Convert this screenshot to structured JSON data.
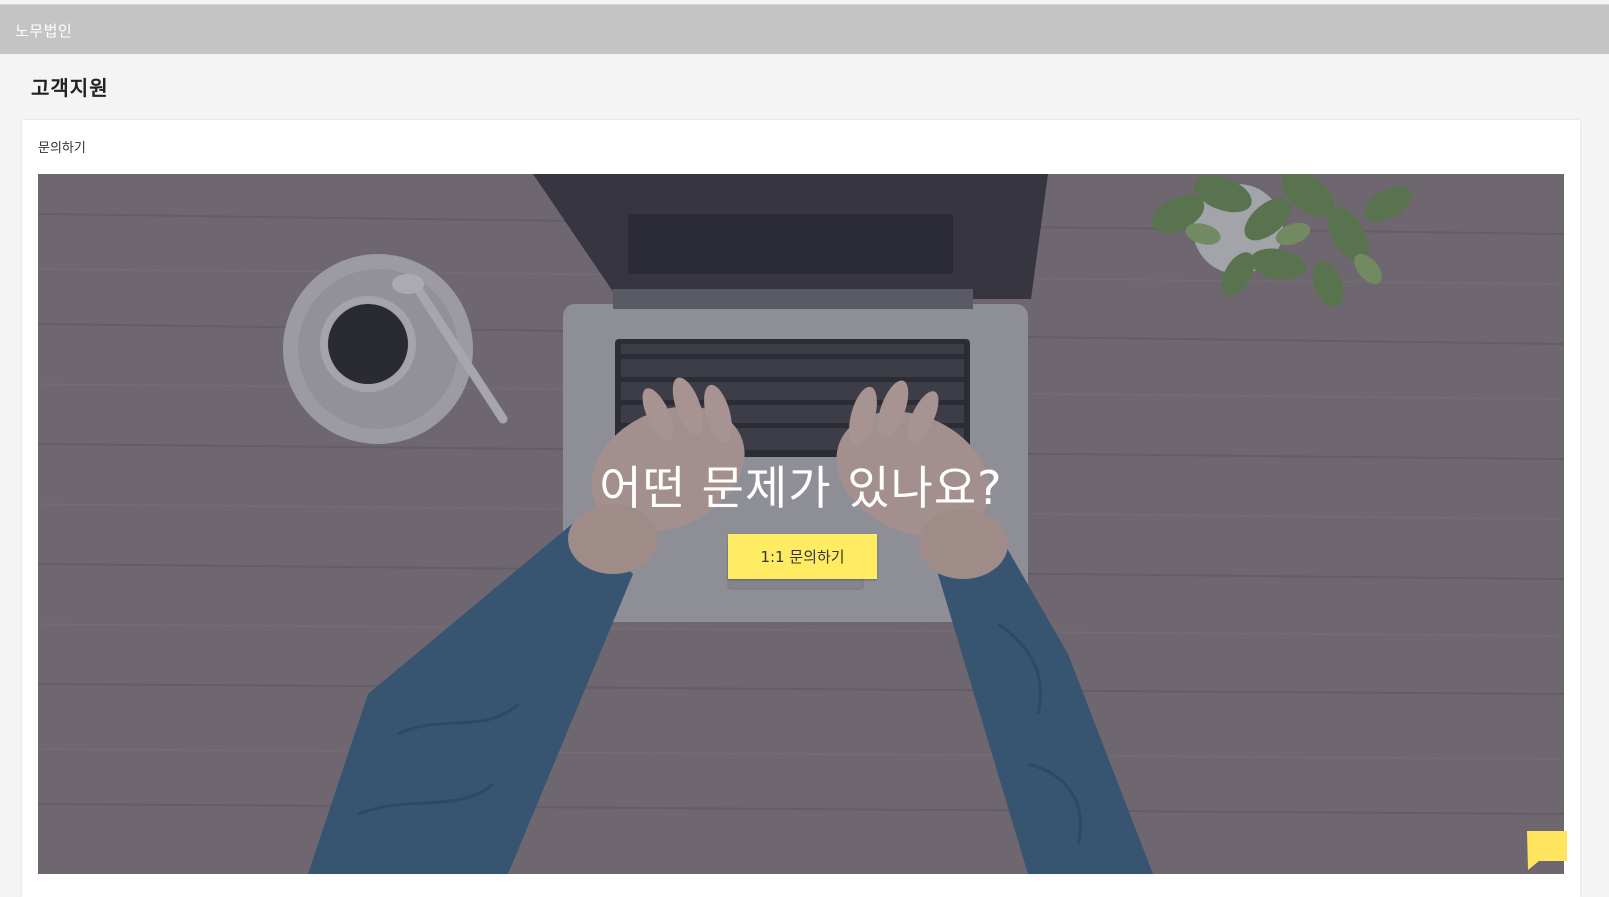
{
  "header": {
    "brand": "노무법인"
  },
  "page": {
    "title": "고객지원"
  },
  "card": {
    "title": "문의하기"
  },
  "hero": {
    "heading": "어떤 문제가 있나요?",
    "button_label": "1:1 문의하기"
  },
  "chat": {
    "icon": "chat-bubble-icon"
  },
  "colors": {
    "header_bg": "#c4c4c4",
    "accent": "#ffec62",
    "page_bg": "#f4f4f4"
  }
}
